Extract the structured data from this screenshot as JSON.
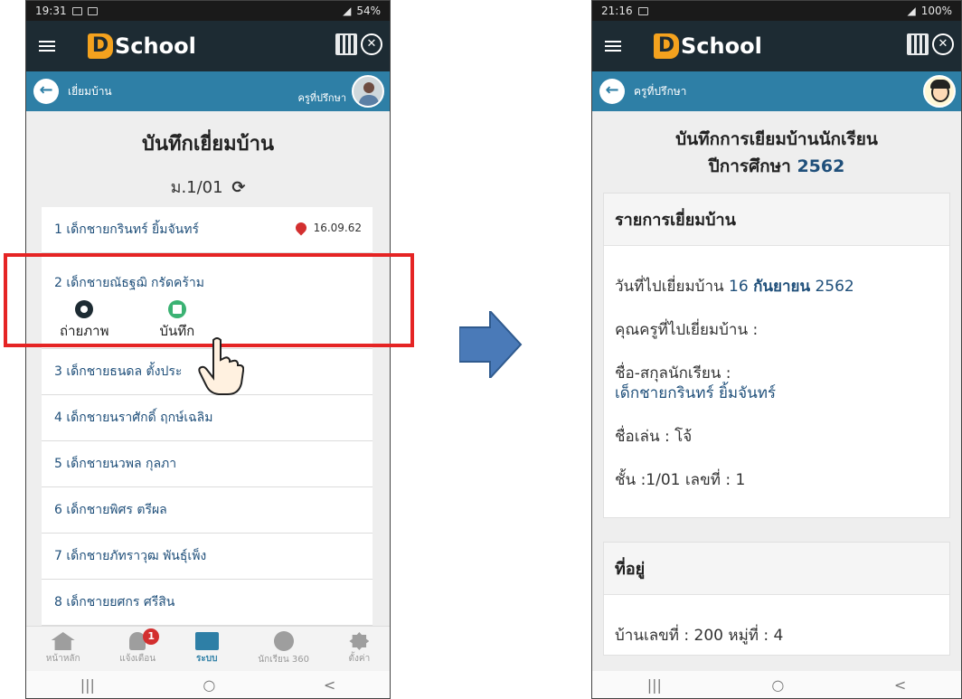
{
  "left": {
    "status": {
      "time": "19:31",
      "battery": "54%"
    },
    "app": {
      "logo_letter": "D",
      "logo_text": "School"
    },
    "subbar": {
      "title": "เยี่ยมบ้าน",
      "teacher": "ครูที่ปรึกษา"
    },
    "page_title": "บันทึกเยี่ยมบ้าน",
    "class_label": "ม.1/01",
    "students": [
      {
        "label": "1 เด็กชายกรินทร์ ยิ้มจันทร์",
        "date": "16.09.62"
      },
      {
        "label": "2 เด็กชายณัธฐฌิ กรัดคร้าม"
      },
      {
        "label": "3 เด็กชายธนดล ตั้งประ"
      },
      {
        "label": "4 เด็กชายนราศักดิ์ ฤกษ์เฉลิม"
      },
      {
        "label": "5 เด็กชายนวพล กุลภา"
      },
      {
        "label": "6 เด็กชายพิศร ตรีผล"
      },
      {
        "label": "7 เด็กชายภัทราวุฒ พันธุ์เพ็ง"
      },
      {
        "label": "8 เด็กชายยศกร ศรีสิน"
      }
    ],
    "actions": {
      "photo": "ถ่ายภาพ",
      "record": "บันทึก"
    },
    "nav": [
      {
        "label": "หน้าหลัก"
      },
      {
        "label": "แจ้งเตือน",
        "badge": "1"
      },
      {
        "label": "ระบบ"
      },
      {
        "label": "นักเรียน 360"
      },
      {
        "label": "ตั้งค่า"
      }
    ]
  },
  "right": {
    "status": {
      "time": "21:16",
      "battery": "100%"
    },
    "app": {
      "logo_letter": "D",
      "logo_text": "School"
    },
    "subbar": {
      "title": "ครูที่ปรึกษา"
    },
    "title_line1": "บันทึกการเยียมบ้านนักเรียน",
    "title_line2_prefix": "ปีการศึกษา ",
    "title_year": "2562",
    "visit_card": {
      "header": "รายการเยี่ยมบ้าน",
      "date_label": "วันที่ไปเยี่ยมบ้าน ",
      "date_day": "16 ",
      "date_month": "กันยายน",
      "date_year": " 2562",
      "teacher_label": "คุณครูที่ไปเยี่ยมบ้าน :",
      "student_label": "ชื่อ-สกุลนักเรียน :",
      "student_name": "เด็กชายกรินทร์ ยิ้มจันทร์",
      "nickname": "ชื่อเล่น : โจ้",
      "class_info": "ชั้น :1/01 เลขที่ : 1"
    },
    "address_card": {
      "header": "ที่อยู่",
      "house": "บ้านเลขที่ : 200 หมู่ที่ : 4"
    }
  },
  "colors": {
    "appbar": "#1d2b33",
    "subbar": "#2e7fa6",
    "logo_accent": "#f4a21e",
    "highlight": "#e52424",
    "arrow": "#4a7ab8"
  },
  "android_nav": {
    "recent": "|||",
    "home": "○",
    "back": "<"
  }
}
